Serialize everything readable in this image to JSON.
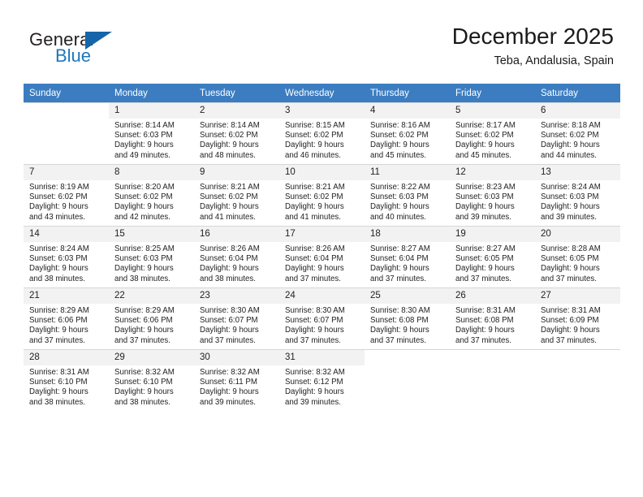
{
  "brand": {
    "name_part1": "General",
    "name_part2": "Blue",
    "triangle_icon": "triangle-icon"
  },
  "header": {
    "title": "December 2025",
    "subtitle": "Teba, Andalusia, Spain"
  },
  "calendar": {
    "weekday_headers": [
      "Sunday",
      "Monday",
      "Tuesday",
      "Wednesday",
      "Thursday",
      "Friday",
      "Saturday"
    ],
    "header_bg": "#3b7dc0",
    "header_text_color": "#ffffff",
    "daynum_bg": "#f2f2f2",
    "grid_line_color": "#d6d6d6",
    "weeks": [
      [
        {
          "day": "",
          "sunrise": "",
          "sunset": "",
          "daylight_line1": "",
          "daylight_line2": ""
        },
        {
          "day": "1",
          "sunrise": "Sunrise: 8:14 AM",
          "sunset": "Sunset: 6:03 PM",
          "daylight_line1": "Daylight: 9 hours",
          "daylight_line2": "and 49 minutes."
        },
        {
          "day": "2",
          "sunrise": "Sunrise: 8:14 AM",
          "sunset": "Sunset: 6:02 PM",
          "daylight_line1": "Daylight: 9 hours",
          "daylight_line2": "and 48 minutes."
        },
        {
          "day": "3",
          "sunrise": "Sunrise: 8:15 AM",
          "sunset": "Sunset: 6:02 PM",
          "daylight_line1": "Daylight: 9 hours",
          "daylight_line2": "and 46 minutes."
        },
        {
          "day": "4",
          "sunrise": "Sunrise: 8:16 AM",
          "sunset": "Sunset: 6:02 PM",
          "daylight_line1": "Daylight: 9 hours",
          "daylight_line2": "and 45 minutes."
        },
        {
          "day": "5",
          "sunrise": "Sunrise: 8:17 AM",
          "sunset": "Sunset: 6:02 PM",
          "daylight_line1": "Daylight: 9 hours",
          "daylight_line2": "and 45 minutes."
        },
        {
          "day": "6",
          "sunrise": "Sunrise: 8:18 AM",
          "sunset": "Sunset: 6:02 PM",
          "daylight_line1": "Daylight: 9 hours",
          "daylight_line2": "and 44 minutes."
        }
      ],
      [
        {
          "day": "7",
          "sunrise": "Sunrise: 8:19 AM",
          "sunset": "Sunset: 6:02 PM",
          "daylight_line1": "Daylight: 9 hours",
          "daylight_line2": "and 43 minutes."
        },
        {
          "day": "8",
          "sunrise": "Sunrise: 8:20 AM",
          "sunset": "Sunset: 6:02 PM",
          "daylight_line1": "Daylight: 9 hours",
          "daylight_line2": "and 42 minutes."
        },
        {
          "day": "9",
          "sunrise": "Sunrise: 8:21 AM",
          "sunset": "Sunset: 6:02 PM",
          "daylight_line1": "Daylight: 9 hours",
          "daylight_line2": "and 41 minutes."
        },
        {
          "day": "10",
          "sunrise": "Sunrise: 8:21 AM",
          "sunset": "Sunset: 6:02 PM",
          "daylight_line1": "Daylight: 9 hours",
          "daylight_line2": "and 41 minutes."
        },
        {
          "day": "11",
          "sunrise": "Sunrise: 8:22 AM",
          "sunset": "Sunset: 6:03 PM",
          "daylight_line1": "Daylight: 9 hours",
          "daylight_line2": "and 40 minutes."
        },
        {
          "day": "12",
          "sunrise": "Sunrise: 8:23 AM",
          "sunset": "Sunset: 6:03 PM",
          "daylight_line1": "Daylight: 9 hours",
          "daylight_line2": "and 39 minutes."
        },
        {
          "day": "13",
          "sunrise": "Sunrise: 8:24 AM",
          "sunset": "Sunset: 6:03 PM",
          "daylight_line1": "Daylight: 9 hours",
          "daylight_line2": "and 39 minutes."
        }
      ],
      [
        {
          "day": "14",
          "sunrise": "Sunrise: 8:24 AM",
          "sunset": "Sunset: 6:03 PM",
          "daylight_line1": "Daylight: 9 hours",
          "daylight_line2": "and 38 minutes."
        },
        {
          "day": "15",
          "sunrise": "Sunrise: 8:25 AM",
          "sunset": "Sunset: 6:03 PM",
          "daylight_line1": "Daylight: 9 hours",
          "daylight_line2": "and 38 minutes."
        },
        {
          "day": "16",
          "sunrise": "Sunrise: 8:26 AM",
          "sunset": "Sunset: 6:04 PM",
          "daylight_line1": "Daylight: 9 hours",
          "daylight_line2": "and 38 minutes."
        },
        {
          "day": "17",
          "sunrise": "Sunrise: 8:26 AM",
          "sunset": "Sunset: 6:04 PM",
          "daylight_line1": "Daylight: 9 hours",
          "daylight_line2": "and 37 minutes."
        },
        {
          "day": "18",
          "sunrise": "Sunrise: 8:27 AM",
          "sunset": "Sunset: 6:04 PM",
          "daylight_line1": "Daylight: 9 hours",
          "daylight_line2": "and 37 minutes."
        },
        {
          "day": "19",
          "sunrise": "Sunrise: 8:27 AM",
          "sunset": "Sunset: 6:05 PM",
          "daylight_line1": "Daylight: 9 hours",
          "daylight_line2": "and 37 minutes."
        },
        {
          "day": "20",
          "sunrise": "Sunrise: 8:28 AM",
          "sunset": "Sunset: 6:05 PM",
          "daylight_line1": "Daylight: 9 hours",
          "daylight_line2": "and 37 minutes."
        }
      ],
      [
        {
          "day": "21",
          "sunrise": "Sunrise: 8:29 AM",
          "sunset": "Sunset: 6:06 PM",
          "daylight_line1": "Daylight: 9 hours",
          "daylight_line2": "and 37 minutes."
        },
        {
          "day": "22",
          "sunrise": "Sunrise: 8:29 AM",
          "sunset": "Sunset: 6:06 PM",
          "daylight_line1": "Daylight: 9 hours",
          "daylight_line2": "and 37 minutes."
        },
        {
          "day": "23",
          "sunrise": "Sunrise: 8:30 AM",
          "sunset": "Sunset: 6:07 PM",
          "daylight_line1": "Daylight: 9 hours",
          "daylight_line2": "and 37 minutes."
        },
        {
          "day": "24",
          "sunrise": "Sunrise: 8:30 AM",
          "sunset": "Sunset: 6:07 PM",
          "daylight_line1": "Daylight: 9 hours",
          "daylight_line2": "and 37 minutes."
        },
        {
          "day": "25",
          "sunrise": "Sunrise: 8:30 AM",
          "sunset": "Sunset: 6:08 PM",
          "daylight_line1": "Daylight: 9 hours",
          "daylight_line2": "and 37 minutes."
        },
        {
          "day": "26",
          "sunrise": "Sunrise: 8:31 AM",
          "sunset": "Sunset: 6:08 PM",
          "daylight_line1": "Daylight: 9 hours",
          "daylight_line2": "and 37 minutes."
        },
        {
          "day": "27",
          "sunrise": "Sunrise: 8:31 AM",
          "sunset": "Sunset: 6:09 PM",
          "daylight_line1": "Daylight: 9 hours",
          "daylight_line2": "and 37 minutes."
        }
      ],
      [
        {
          "day": "28",
          "sunrise": "Sunrise: 8:31 AM",
          "sunset": "Sunset: 6:10 PM",
          "daylight_line1": "Daylight: 9 hours",
          "daylight_line2": "and 38 minutes."
        },
        {
          "day": "29",
          "sunrise": "Sunrise: 8:32 AM",
          "sunset": "Sunset: 6:10 PM",
          "daylight_line1": "Daylight: 9 hours",
          "daylight_line2": "and 38 minutes."
        },
        {
          "day": "30",
          "sunrise": "Sunrise: 8:32 AM",
          "sunset": "Sunset: 6:11 PM",
          "daylight_line1": "Daylight: 9 hours",
          "daylight_line2": "and 39 minutes."
        },
        {
          "day": "31",
          "sunrise": "Sunrise: 8:32 AM",
          "sunset": "Sunset: 6:12 PM",
          "daylight_line1": "Daylight: 9 hours",
          "daylight_line2": "and 39 minutes."
        },
        {
          "day": "",
          "sunrise": "",
          "sunset": "",
          "daylight_line1": "",
          "daylight_line2": ""
        },
        {
          "day": "",
          "sunrise": "",
          "sunset": "",
          "daylight_line1": "",
          "daylight_line2": ""
        },
        {
          "day": "",
          "sunrise": "",
          "sunset": "",
          "daylight_line1": "",
          "daylight_line2": ""
        }
      ]
    ]
  }
}
